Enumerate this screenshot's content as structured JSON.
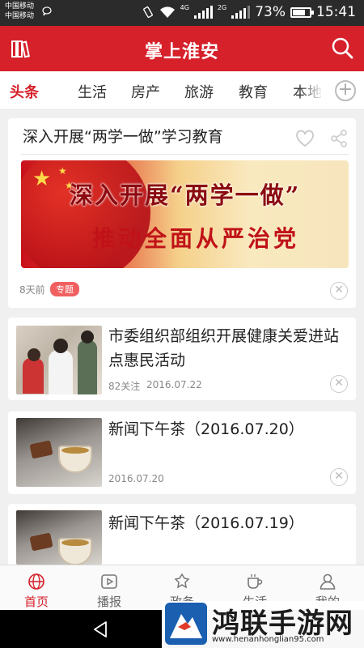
{
  "status_bar": {
    "carrier_1": "中国移动",
    "carrier_2": "中国移动",
    "network_1": "4G",
    "network_2": "2G",
    "battery": "73%",
    "time": "15:41"
  },
  "header": {
    "title": "掌上淮安",
    "left_icon": "books-icon",
    "right_icon": "search-icon",
    "bg_color": "#d6202a"
  },
  "tabs": [
    {
      "label": "头条",
      "active": true
    },
    {
      "label": "生活"
    },
    {
      "label": "房产"
    },
    {
      "label": "旅游"
    },
    {
      "label": "教育"
    },
    {
      "label": "本地"
    }
  ],
  "feature": {
    "title": "深入开展“两学一做”学习教育",
    "banner_line1": "深入开展“两学一做”",
    "banner_line2": "推动全面从严治党",
    "time": "8天前",
    "tag": "专题"
  },
  "news": [
    {
      "title": "市委组织部组织开展健康关爱进站点惠民活动",
      "follows": "82关注",
      "date": "2016.07.22",
      "thumb": "clinic"
    },
    {
      "title": "新闻下午茶（2016.07.20）",
      "date": "2016.07.20",
      "thumb": "tea"
    },
    {
      "title": "新闻下午茶（2016.07.19）",
      "thumb": "tea"
    }
  ],
  "bottom_nav": [
    {
      "label": "首页",
      "icon": "globe-icon",
      "active": true
    },
    {
      "label": "播报",
      "icon": "play-icon"
    },
    {
      "label": "政务",
      "icon": "building-icon"
    },
    {
      "label": "生活",
      "icon": "cup-icon"
    },
    {
      "label": "我的",
      "icon": "user-icon"
    }
  ],
  "watermark": {
    "text": "鸿联手游网",
    "url": "www.henanhonglian95.com"
  },
  "colors": {
    "accent": "#d6202a",
    "tag": "#f06060"
  }
}
